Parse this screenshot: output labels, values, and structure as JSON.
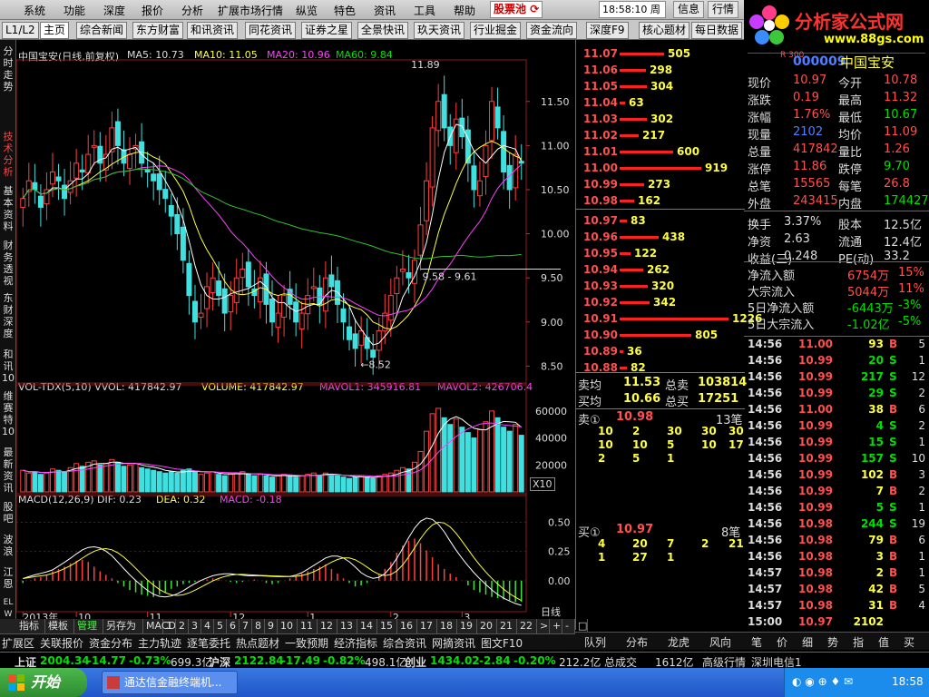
{
  "menu": [
    "系统",
    "功能",
    "深度",
    "报价",
    "分析",
    "扩展市场行情",
    "纵览",
    "特色",
    "资讯",
    "工具",
    "帮助"
  ],
  "stock_pool_label": "股票池",
  "clock": "18:58:10 周日",
  "top_buttons": [
    "信息",
    "行情"
  ],
  "logo": {
    "title": "分析家公式网",
    "url": "www.88gs.com"
  },
  "tabs": [
    "L1/L2",
    "主页",
    "综合新闻",
    "东方财富",
    "和讯资讯",
    "同花资讯",
    "证券之星",
    "全景快讯",
    "玖天资讯",
    "行业掘金",
    "资金流向",
    "深度F9",
    "核心题材",
    "每日数据"
  ],
  "left_sidebar": [
    "分时走势",
    "技术分析",
    "基本资料",
    "财务透视",
    "东财深度",
    "和讯10",
    "维赛特10",
    "最新资讯",
    "股吧",
    "波浪",
    "江恩",
    "ELWAVE"
  ],
  "chart_header": {
    "title": "中国宝安(日线,前复权)",
    "ma5": "MA5: 10.73",
    "ma10": "MA10: 11.05",
    "ma20": "MA20: 10.96",
    "ma60": "MA60: 9.84",
    "vol": "VOL-TDX(5,10)  VVOL: 417842.97",
    "volume": "VOLUME: 417842.97",
    "mavol1": "MAVOL1: 345916.81",
    "mavol2": "MAVOL2: 426706.4",
    "macd": "MACD(12,26,9)  DIF: 0.23",
    "dea": "DEA: 0.32",
    "macdv": "MACD: -0.18",
    "hi_label": "11.89",
    "lo_label": "8.52",
    "range_label": "9.58 - 9.61",
    "x10": "X10",
    "period": "日线"
  },
  "chart_data": {
    "type": "candlestick",
    "price_ticks": [
      "11.50",
      "11.00",
      "10.50",
      "10.00",
      "9.50",
      "9.00",
      "8.50"
    ],
    "price_range": [
      8.35,
      11.95
    ],
    "vol_ticks": [
      "60000",
      "40000",
      "20000"
    ],
    "macd_ticks": [
      "0.50",
      "0.25",
      "0.00"
    ],
    "x_ticks": [
      "2013年",
      "10",
      "11",
      "12",
      "1",
      "2",
      "3"
    ],
    "close": [
      10.4,
      10.6,
      10.5,
      10.3,
      10.5,
      10.7,
      10.6,
      10.4,
      10.6,
      10.8,
      10.7,
      10.9,
      11.0,
      10.8,
      10.9,
      11.2,
      11.0,
      10.8,
      10.9,
      11.0,
      10.8,
      10.7,
      10.6,
      10.5,
      10.4,
      10.2,
      10.0,
      9.7,
      9.3,
      9.0,
      9.1,
      9.4,
      9.5,
      9.3,
      9.1,
      9.3,
      9.5,
      9.6,
      9.4,
      9.3,
      9.5,
      9.2,
      9.0,
      9.1,
      9.3,
      9.2,
      9.0,
      9.1,
      9.3,
      9.4,
      9.2,
      9.5,
      9.4,
      9.2,
      9.0,
      8.8,
      8.7,
      8.9,
      8.7,
      8.6,
      8.9,
      9.1,
      9.3,
      9.5,
      9.6,
      9.5,
      9.7,
      10.1,
      10.6,
      11.2,
      11.5,
      11.2,
      11.0,
      11.3,
      11.1,
      10.8,
      10.5,
      10.6,
      11.0,
      11.5,
      11.2,
      10.7,
      10.5,
      10.9,
      10.8
    ],
    "volume": [
      16000,
      14000,
      15000,
      13000,
      14000,
      17000,
      16000,
      15000,
      18000,
      21000,
      19000,
      22000,
      23000,
      20000,
      21000,
      24000,
      22000,
      19000,
      20000,
      21000,
      18000,
      17000,
      16000,
      15000,
      14000,
      15000,
      14000,
      16000,
      17000,
      15000,
      13000,
      14000,
      15000,
      13000,
      12000,
      13000,
      14000,
      15000,
      13000,
      12000,
      13000,
      12000,
      11000,
      12000,
      13000,
      12000,
      11000,
      12000,
      13000,
      14000,
      12000,
      14000,
      13000,
      12000,
      11000,
      10000,
      11000,
      12000,
      11000,
      10000,
      12000,
      13000,
      14000,
      16000,
      18000,
      17000,
      22000,
      30000,
      45000,
      58000,
      62000,
      55000,
      50000,
      54000,
      48000,
      44000,
      40000,
      46000,
      52000,
      60000,
      55000,
      48000,
      45000,
      50000,
      42000
    ],
    "macd": [
      -0.02,
      0.0,
      0.02,
      0.03,
      0.05,
      0.08,
      0.1,
      0.12,
      0.15,
      0.17,
      0.18,
      0.16,
      0.12,
      0.08,
      0.05,
      0.02,
      -0.02,
      -0.05,
      -0.08,
      -0.1,
      -0.12,
      -0.13,
      -0.14,
      -0.12,
      -0.1,
      -0.07,
      -0.05,
      -0.03,
      -0.02,
      -0.01,
      0.0,
      0.01,
      0.02,
      0.01,
      0.0,
      -0.01,
      -0.02,
      -0.01,
      0.0,
      0.01,
      0.0,
      -0.02,
      -0.03,
      -0.02,
      0.0,
      0.02,
      0.04,
      0.06,
      0.08,
      0.1,
      0.12,
      0.14,
      0.1,
      0.06,
      0.02,
      -0.02,
      -0.05,
      -0.04,
      -0.02,
      0.0,
      0.05,
      0.1,
      0.16,
      0.24,
      0.3,
      0.34,
      0.36,
      0.32,
      0.26,
      0.2,
      0.14,
      0.1,
      0.06,
      0.03,
      0.0,
      -0.04,
      -0.08,
      -0.1,
      -0.12,
      -0.14,
      -0.15,
      -0.16,
      -0.17,
      -0.18,
      -0.18
    ]
  },
  "order_book_asks": [
    {
      "price": "11.07",
      "vol": "505"
    },
    {
      "price": "11.06",
      "vol": "298"
    },
    {
      "price": "11.05",
      "vol": "304"
    },
    {
      "price": "11.04",
      "vol": "63"
    },
    {
      "price": "11.03",
      "vol": "302"
    },
    {
      "price": "11.02",
      "vol": "217"
    },
    {
      "price": "11.01",
      "vol": "600"
    },
    {
      "price": "11.00",
      "vol": "919"
    },
    {
      "price": "10.99",
      "vol": "273"
    },
    {
      "price": "10.98",
      "vol": "162"
    }
  ],
  "order_book_bids": [
    {
      "price": "10.97",
      "vol": "83"
    },
    {
      "price": "10.96",
      "vol": "438"
    },
    {
      "price": "10.95",
      "vol": "122"
    },
    {
      "price": "10.94",
      "vol": "262"
    },
    {
      "price": "10.93",
      "vol": "320"
    },
    {
      "price": "10.92",
      "vol": "342"
    },
    {
      "price": "10.91",
      "vol": "1226"
    },
    {
      "price": "10.90",
      "vol": "805"
    },
    {
      "price": "10.89",
      "vol": "36"
    },
    {
      "price": "10.88",
      "vol": "82"
    }
  ],
  "ob_summary": {
    "sell_avg_l": "卖均",
    "sell_avg": "11.53",
    "sell_total_l": "总卖",
    "sell_total": "103814",
    "buy_avg_l": "买均",
    "buy_avg": "10.66",
    "buy_total_l": "总买",
    "buy_total": "17251"
  },
  "sell1": {
    "label": "卖①",
    "price": "10.98",
    "count": "13笔",
    "queue": [
      "10",
      "2",
      "30",
      "30",
      "30",
      "10",
      "10",
      "5",
      "10",
      "17",
      "2",
      "5",
      "1"
    ]
  },
  "buy1": {
    "label": "买①",
    "price": "10.97",
    "count": "8笔",
    "queue": [
      "4",
      "20",
      "7",
      "2",
      "21",
      "1",
      "27",
      "1"
    ]
  },
  "stock": {
    "code": "000009",
    "name": "中国宝安",
    "tag": "R 300"
  },
  "info_rows": [
    [
      "现价",
      "10.97",
      "今开",
      "10.78"
    ],
    [
      "涨跌",
      "0.19",
      "最高",
      "11.32"
    ],
    [
      "涨幅",
      "1.76%",
      "最低",
      "10.67"
    ],
    [
      "现量",
      "2102",
      "均价",
      "11.09"
    ],
    [
      "总量",
      "417842",
      "量比",
      "1.26"
    ],
    [
      "涨停",
      "11.86",
      "跌停",
      "9.70"
    ],
    [
      "总笔",
      "15565",
      "每笔",
      "26.8"
    ],
    [
      "外盘",
      "243415",
      "内盘",
      "174427"
    ],
    [
      "换手",
      "3.37%",
      "股本",
      "12.5亿"
    ],
    [
      "净资",
      "2.63",
      "流通",
      "12.4亿"
    ],
    [
      "收益(三)",
      "0.248",
      "PE(动)",
      "33.2"
    ]
  ],
  "flow_rows": [
    [
      "净流入额",
      "6754万",
      "15%"
    ],
    [
      "大宗流入",
      "5044万",
      "11%"
    ],
    [
      "5日净流入额",
      "-6443万",
      "-3%"
    ],
    [
      "5日大宗流入",
      "-1.02亿",
      "-5%"
    ]
  ],
  "trades": [
    [
      "14:56",
      "11.00",
      "93",
      "B",
      "5"
    ],
    [
      "14:56",
      "10.99",
      "20",
      "S",
      "1"
    ],
    [
      "14:56",
      "10.99",
      "217",
      "S",
      "12"
    ],
    [
      "14:56",
      "10.99",
      "29",
      "S",
      "2"
    ],
    [
      "14:56",
      "11.00",
      "38",
      "B",
      "6"
    ],
    [
      "14:56",
      "10.99",
      "4",
      "S",
      "2"
    ],
    [
      "14:56",
      "10.99",
      "15",
      "S",
      "1"
    ],
    [
      "14:56",
      "10.99",
      "157",
      "S",
      "10"
    ],
    [
      "14:56",
      "10.99",
      "102",
      "B",
      "3"
    ],
    [
      "14:56",
      "10.99",
      "7",
      "B",
      "2"
    ],
    [
      "14:56",
      "10.99",
      "5",
      "S",
      "1"
    ],
    [
      "14:56",
      "10.98",
      "244",
      "S",
      "19"
    ],
    [
      "14:56",
      "10.98",
      "79",
      "B",
      "6"
    ],
    [
      "14:56",
      "10.98",
      "3",
      "B",
      "1"
    ],
    [
      "14:57",
      "10.98",
      "2",
      "B",
      "1"
    ],
    [
      "14:57",
      "10.98",
      "42",
      "B",
      "5"
    ],
    [
      "14:57",
      "10.98",
      "31",
      "B",
      "4"
    ],
    [
      "15:00",
      "10.97",
      "2102",
      "",
      ""
    ]
  ],
  "bottom_tabs": [
    "指标",
    "模板",
    "管理",
    "另存为",
    "MACD",
    "1",
    "2",
    "3",
    "4",
    "5",
    "6",
    "7",
    "8",
    "9",
    "10",
    "11",
    "12",
    "13",
    "14",
    "15",
    "16",
    "17",
    "18",
    "19",
    "20",
    "21",
    "22",
    ">",
    "+",
    "-",
    "□"
  ],
  "module_tabs": [
    "扩展区",
    "关联报价",
    "资金分布",
    "主力轨迹",
    "逐笔委托",
    "热点题材",
    "一致预期",
    "经济指标",
    "综合资讯",
    "网摘资讯",
    "图文F10"
  ],
  "queue_tabs": [
    "队列",
    "分布",
    "龙虎",
    "风向"
  ],
  "right_tabs": [
    "笔",
    "价",
    "细",
    "势",
    "指",
    "值",
    "买"
  ],
  "index_bar": {
    "sh_l": "上证",
    "sh": "2004.34",
    "sh_c": "-14.77",
    "sh_p": "-0.73%",
    "sh_v": "699.3亿",
    "sz_l": "沪深",
    "sz": "2122.84",
    "sz_c": "-17.49",
    "sz_p": "-0.82%",
    "sz_v": "498.1亿",
    "cy_l": "创业",
    "cy": "1434.02",
    "cy_c": "-2.84",
    "cy_p": "-0.20%",
    "cy_v": "212.2亿",
    "deal_l": "总成交",
    "deal": "1612亿",
    "status": "高级行情_深圳电信1"
  },
  "taskbar": {
    "start": "开始",
    "task": "通达信金融终端机...",
    "time": "18:58"
  }
}
